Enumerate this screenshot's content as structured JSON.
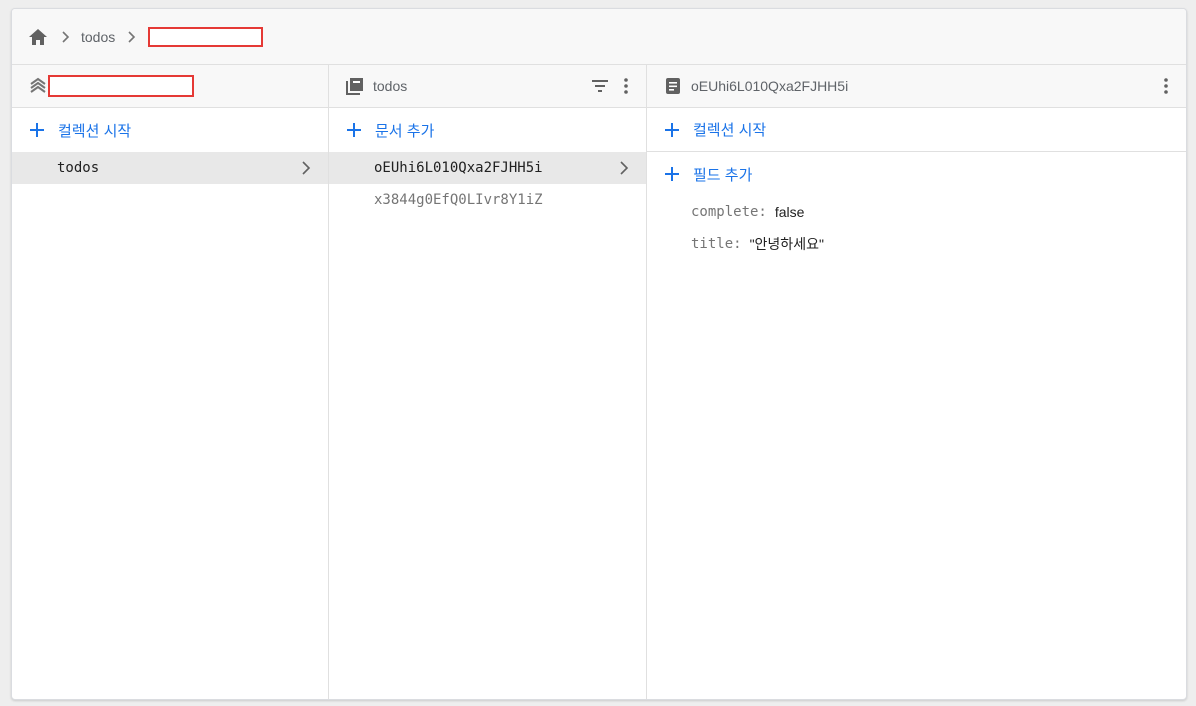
{
  "breadcrumb": {
    "items": [
      "todos"
    ]
  },
  "columns": {
    "root": {
      "add_label": "컬렉션 시작",
      "items": [
        {
          "label": "todos",
          "selected": true
        }
      ]
    },
    "collection": {
      "title": "todos",
      "add_label": "문서 추가",
      "items": [
        {
          "label": "oEUhi6L010Qxa2FJHH5i",
          "selected": true
        },
        {
          "label": "x3844g0EfQ0LIvr8Y1iZ",
          "selected": false
        }
      ]
    },
    "document": {
      "title": "oEUhi6L010Qxa2FJHH5i",
      "add_collection_label": "컬렉션 시작",
      "add_field_label": "필드 추가",
      "fields": [
        {
          "key": "complete:",
          "value": "false"
        },
        {
          "key": "title:",
          "value": "\"안녕하세요\""
        }
      ]
    }
  },
  "colors": {
    "accent": "#1a73e8",
    "redaction": "#e53935"
  },
  "icons": {
    "home": "home-icon",
    "separator": "chevron-right-icon",
    "root": "database-stack-icon",
    "collection": "collection-icon",
    "document": "document-icon",
    "filter": "filter-icon",
    "menu": "more-vert-icon",
    "add": "plus-icon"
  }
}
